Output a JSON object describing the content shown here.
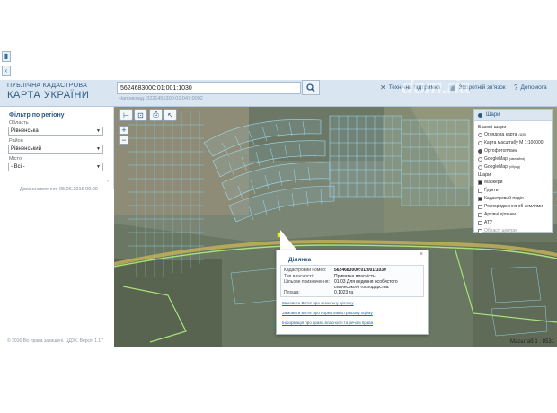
{
  "header": {
    "brand_top": "ПУБЛІЧНА КАДАСТРОВА",
    "brand_main": "КАРТА УКРАЇНИ",
    "search_value": "5624683000:01:001:1030",
    "search_hint": "Наприклад: 3221455300:01:047:0002",
    "links": [
      {
        "label": "Технічна підтримка",
        "icon": "wrench-icon"
      },
      {
        "label": "Зворотній зв'язок",
        "icon": "feedback-icon"
      },
      {
        "label": "Допомога",
        "icon": "help-icon"
      }
    ]
  },
  "filter": {
    "title": "Фільтр по регіону",
    "fields": [
      {
        "label": "Область",
        "value": "Рівненська"
      },
      {
        "label": "Район",
        "value": "Рівненський"
      },
      {
        "label": "Місто",
        "value": "- Всі -"
      }
    ],
    "update_date": "Дата оновлення: 05.06.2016 00:00"
  },
  "footer": {
    "copyright": "© 2016 Всі права захищені. ЦДЗК. Версія 1.17"
  },
  "layers": {
    "title": "Шари",
    "base_title": "Базові шари",
    "base_items": [
      {
        "label": "Оглядова карта",
        "sup": "(ДЗК)",
        "selected": false
      },
      {
        "label": "Карта масштабу М 1:100000",
        "sup": "",
        "selected": false
      },
      {
        "label": "Ортофотоплани",
        "sup": "",
        "selected": true
      },
      {
        "label": "GoogleMap",
        "sup": "(звичайна)",
        "selected": false
      },
      {
        "label": "GoogleMap",
        "sup": "(гібрид)",
        "selected": false
      }
    ],
    "overlay_title": "Шари",
    "overlay_items": [
      {
        "label": "Маркери",
        "checked": true,
        "dim": false
      },
      {
        "label": "Ґрунти",
        "checked": false,
        "dim": false
      },
      {
        "label": "Кадастровий поділ",
        "checked": true,
        "dim": false
      },
      {
        "label": "Розпорядження об землями",
        "checked": false,
        "dim": false
      },
      {
        "label": "Архівні ділянки",
        "checked": false,
        "dim": false
      },
      {
        "label": "АТУ",
        "checked": false,
        "dim": false
      },
      {
        "label": "Області центри",
        "checked": false,
        "dim": true
      }
    ]
  },
  "popup": {
    "tab": "Ділянка",
    "close": "×",
    "rows": [
      {
        "key": "Кадастровий номер:",
        "value": "5624683000:01:001:1030",
        "bold": true
      },
      {
        "key": "Тип власності:",
        "value": "Приватна власність",
        "bold": false
      },
      {
        "key": "Цільове призначення:",
        "value": "01.03 Для ведення особистого",
        "bold": false
      },
      {
        "key": "",
        "value": "селянського господарства",
        "bold": false
      },
      {
        "key": "Площа:",
        "value": "0.1023 га",
        "bold": false
      }
    ],
    "links": [
      "Замовити Витяг про земельну ділянку",
      "Замовити Витяг про нормативно грошову оцінку",
      "Інформація про право власності та речові права"
    ]
  },
  "scale": "Масштаб 1 : 8531",
  "watermark": "dom.ria"
}
